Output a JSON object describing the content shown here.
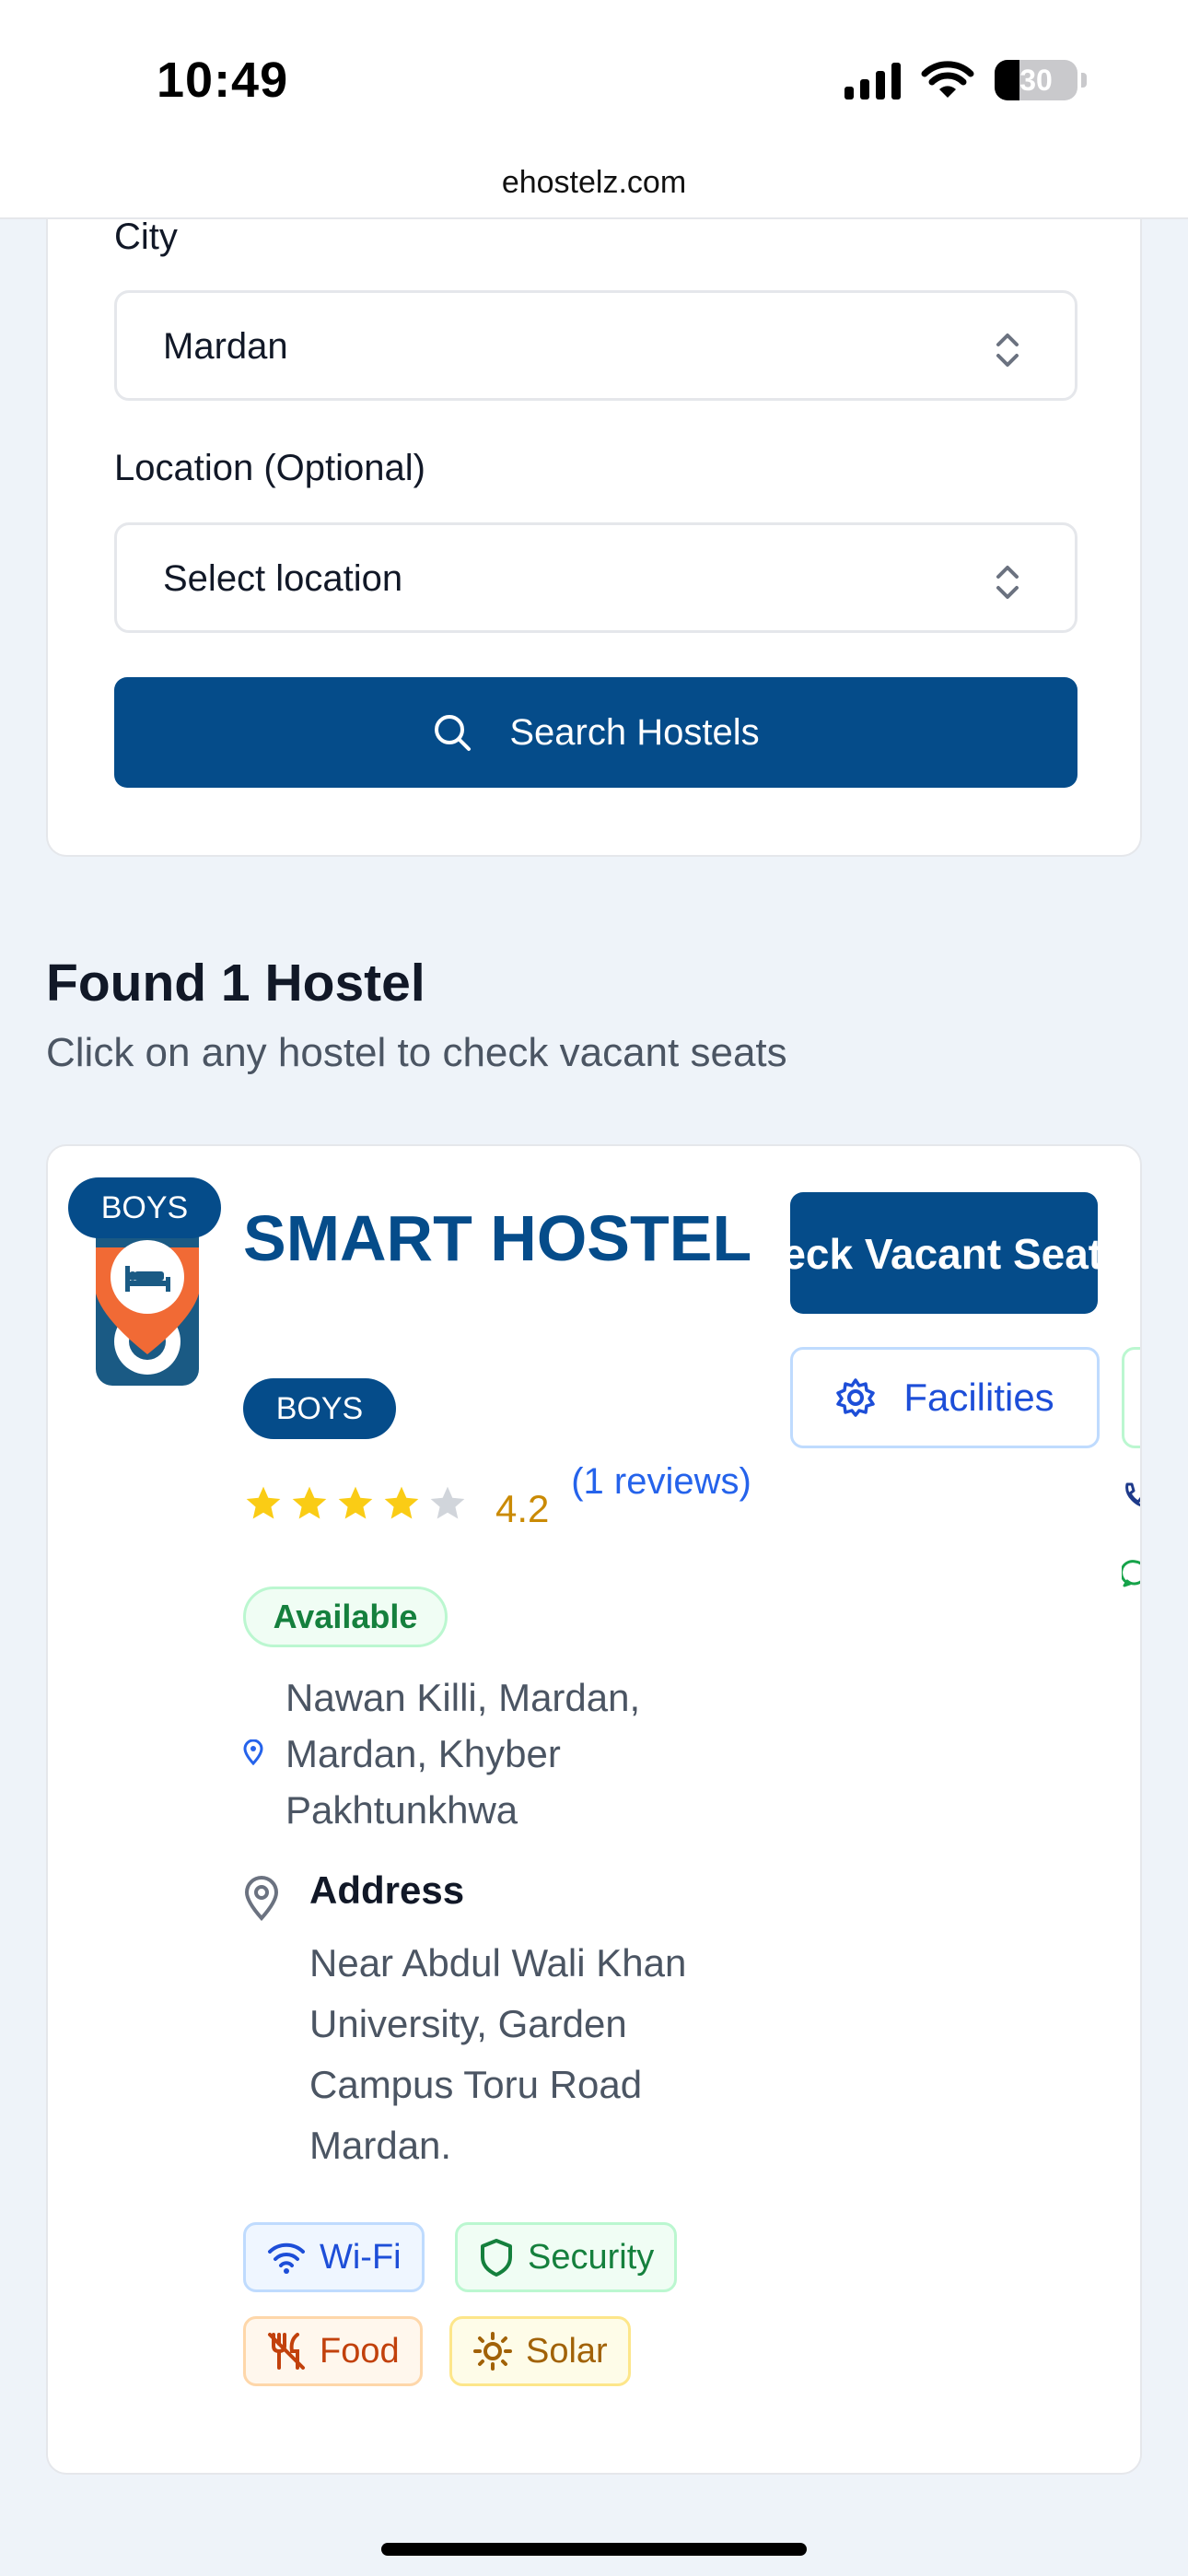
{
  "status_bar": {
    "time": "10:49",
    "battery": "30"
  },
  "browser": {
    "url": "ehostelz.com"
  },
  "search": {
    "city_label": "City",
    "city_value": "Mardan",
    "location_label": "Location (Optional)",
    "location_value": "Select location",
    "button_label": "Search Hostels"
  },
  "results": {
    "title": "Found 1 Hostel",
    "subtitle": "Click on any hostel to check vacant seats"
  },
  "hostel": {
    "logo_badge": "BOYS",
    "name": "SMART HOSTEL",
    "type_badge": "BOYS",
    "rating": "4.2",
    "rating_value": 4.2,
    "stars_filled": 4,
    "stars_total": 5,
    "reviews": "(1 reviews)",
    "availability": "Available",
    "location": "Nawan Killi, Mardan, Mardan, Khyber Pakhtunkhwa",
    "address_label": "Address",
    "address": "Near Abdul Wali Khan University, Garden Campus Toru Road Mardan.",
    "check_button": "Check Vacant Seats",
    "facilities_button": "Facilities",
    "amenities": [
      {
        "label": "Wi-Fi",
        "icon": "wifi-icon"
      },
      {
        "label": "Security",
        "icon": "shield-icon"
      },
      {
        "label": "Food",
        "icon": "utensils-off-icon"
      },
      {
        "label": "Solar",
        "icon": "sun-icon"
      }
    ]
  },
  "colors": {
    "primary": "#054c8a",
    "star": "#facc15",
    "rating": "#ca8a04",
    "link": "#2563eb",
    "available": "#15803d"
  }
}
